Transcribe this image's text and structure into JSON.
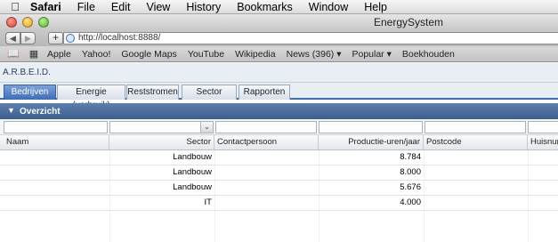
{
  "menubar": {
    "app_name": "Safari",
    "items": [
      "File",
      "Edit",
      "View",
      "History",
      "Bookmarks",
      "Window",
      "Help"
    ]
  },
  "window": {
    "title": "EnergySystem"
  },
  "toolbar": {
    "back_glyph": "◀",
    "forward_glyph": "▶",
    "add_glyph": "+",
    "url": "http://localhost:8888/"
  },
  "bookmarks": {
    "items": [
      "Apple",
      "Yahoo!",
      "Google Maps",
      "YouTube",
      "Wikipedia",
      "News (396) ▾",
      "Popular ▾",
      "Boekhouden"
    ]
  },
  "app": {
    "brand": "A.R.B.E.I.D.",
    "tabs": [
      {
        "label": "Bedrijven",
        "active": true
      },
      {
        "label": "Energie (verbruik)",
        "active": false
      },
      {
        "label": "Reststromen",
        "active": false
      },
      {
        "label": "Sector",
        "active": false
      },
      {
        "label": "Rapporten",
        "active": false
      }
    ],
    "panel_title": "Overzicht",
    "dropdown_glyph": "⌄",
    "columns": {
      "naam": "Naam",
      "sector": "Sector",
      "contactpersoon": "Contactpersoon",
      "productie": "Productie-uren/jaar",
      "postcode": "Postcode",
      "huisnummer": "Huisnur"
    },
    "rows": [
      {
        "naam": "",
        "sector": "Landbouw",
        "contactpersoon": "",
        "productie": "8.784",
        "postcode": ""
      },
      {
        "naam": "",
        "sector": "Landbouw",
        "contactpersoon": "",
        "productie": "8.000",
        "postcode": ""
      },
      {
        "naam": "",
        "sector": "Landbouw",
        "contactpersoon": "",
        "productie": "5.676",
        "postcode": ""
      },
      {
        "naam": "",
        "sector": "IT",
        "contactpersoon": "",
        "productie": "4.000",
        "postcode": ""
      }
    ]
  },
  "colors": {
    "accent": "#3e6db4",
    "panel_header": "#4c6d9c"
  }
}
